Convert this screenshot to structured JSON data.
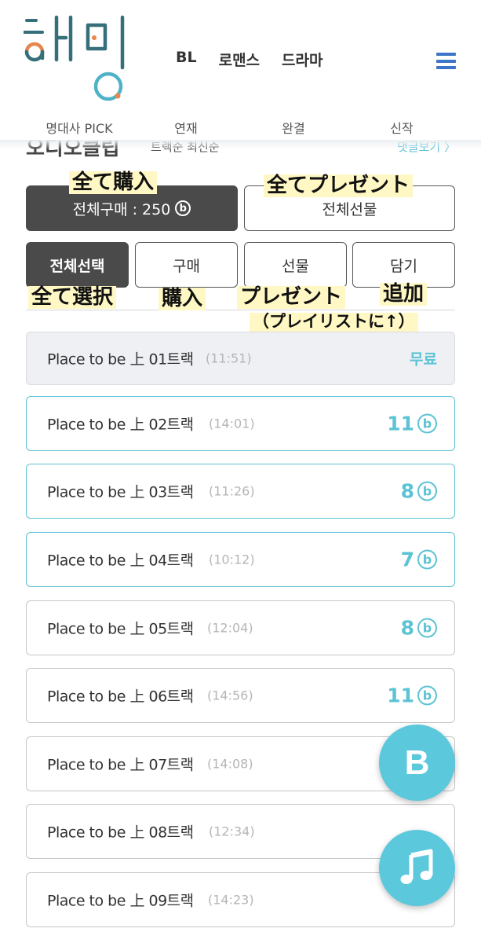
{
  "header": {
    "logo_text": "해밍",
    "top_nav": [
      "BL",
      "로맨스",
      "드라마"
    ],
    "sub_nav": [
      "명대사 PICK",
      "연재",
      "완결",
      "신작"
    ]
  },
  "series_row": {
    "title_partial": "오디오클립",
    "sort": "트랙순  최신순",
    "link": "댓글보기 〉"
  },
  "buttons": {
    "buy_all_label": "전체구매 : 250",
    "gift_all_label": "전체선물",
    "select_all": "전체선택",
    "buy": "구매",
    "gift": "선물",
    "add": "담기"
  },
  "annotations": {
    "buy_all": "全て購入",
    "gift_all": "全てプレゼント",
    "select_all": "全て選択",
    "buy": "購入",
    "gift": "プレゼント",
    "add": "追加",
    "add_note": "（プレイリストに↑）"
  },
  "tracks": [
    {
      "name": "Place to be 上 01트랙",
      "time": "(11:51)",
      "price": "무료",
      "free": true
    },
    {
      "name": "Place to be 上 02트랙",
      "time": "(14:01)",
      "price": "11"
    },
    {
      "name": "Place to be 上 03트랙",
      "time": "(11:26)",
      "price": "8"
    },
    {
      "name": "Place to be 上 04트랙",
      "time": "(10:12)",
      "price": "7"
    },
    {
      "name": "Place to be 上 05트랙",
      "time": "(12:04)",
      "price": "8"
    },
    {
      "name": "Place to be 上 06트랙",
      "time": "(14:56)",
      "price": "11"
    },
    {
      "name": "Place to be 上 07트랙",
      "time": "(14:08)",
      "price": ""
    },
    {
      "name": "Place to be 上 08트랙",
      "time": "(12:34)",
      "price": ""
    },
    {
      "name": "Place to be 上 09트랙",
      "time": "(14:23)",
      "price": ""
    }
  ],
  "currency_symbol": "ⓑ",
  "fab": {
    "b_label": "B",
    "music_icon": "music-note-icon"
  },
  "colors": {
    "accent": "#5cc3d4",
    "dark": "#4a4a4a",
    "menu": "#3e74c7",
    "fab": "#5bc8dc",
    "highlight": "#fff8c5"
  }
}
